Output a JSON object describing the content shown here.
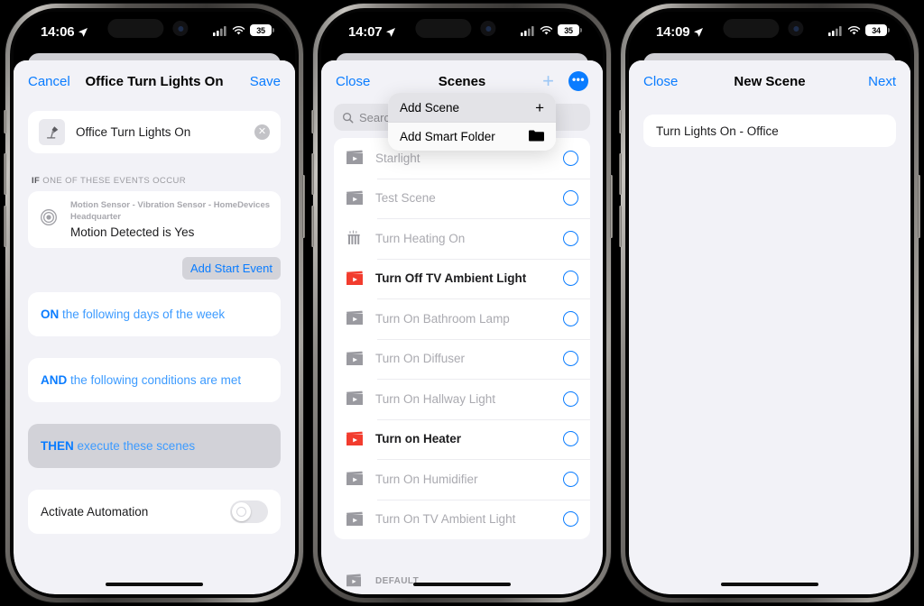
{
  "phones": [
    {
      "status": {
        "time": "14:06",
        "battery": "35",
        "location_icon": "location-arrow-icon",
        "signal_icon": "cellular-signal-icon",
        "wifi_icon": "wifi-icon"
      },
      "nav": {
        "left": "Cancel",
        "title": "Office Turn Lights On",
        "right": "Save"
      },
      "name_field": {
        "icon": "desk-lamp-icon",
        "value": "Office Turn Lights On",
        "clear": "✕"
      },
      "if_section": {
        "prefix": "IF",
        "label": "ONE OF THESE EVENTS OCCUR"
      },
      "event": {
        "icon": "motion-sensor-icon",
        "subtitle": "Motion Sensor - Vibration Sensor - HomeDevices Headquarter",
        "title": "Motion Detected is Yes"
      },
      "add_start_event": "Add Start Event",
      "rules": [
        {
          "keyword": "ON",
          "text": " the following days of the week",
          "pressed": false
        },
        {
          "keyword": "AND",
          "text": " the following conditions are met",
          "pressed": false
        },
        {
          "keyword": "THEN",
          "text": " execute these scenes",
          "pressed": true
        }
      ],
      "toggle": {
        "label": "Activate Automation",
        "state": "off"
      }
    },
    {
      "status": {
        "time": "14:07",
        "battery": "35"
      },
      "nav": {
        "left": "Close",
        "title": "Scenes",
        "add_icon": "plus-icon",
        "more_icon": "ellipsis-circle-icon"
      },
      "search": {
        "placeholder": "Search",
        "icon": "search-icon"
      },
      "context_menu": [
        {
          "label": "Add Scene",
          "icon": "plus-icon"
        },
        {
          "label": "Add Smart Folder",
          "icon": "folder-icon"
        }
      ],
      "scenes": [
        {
          "label": "Starlight",
          "icon": "scene-clapper-icon",
          "accent": "#9a9aa0",
          "active": false
        },
        {
          "label": "Test Scene",
          "icon": "scene-clapper-icon",
          "accent": "#9a9aa0",
          "active": false
        },
        {
          "label": "Turn Heating On",
          "icon": "radiator-icon",
          "accent": "#9a9aa0",
          "active": false
        },
        {
          "label": "Turn Off TV Ambient Light",
          "icon": "scene-clapper-icon",
          "accent": "#f23c2e",
          "active": true
        },
        {
          "label": "Turn On Bathroom Lamp",
          "icon": "scene-clapper-icon",
          "accent": "#9a9aa0",
          "active": false
        },
        {
          "label": "Turn On Diffuser",
          "icon": "scene-clapper-icon",
          "accent": "#9a9aa0",
          "active": false
        },
        {
          "label": "Turn On Hallway Light",
          "icon": "scene-clapper-icon",
          "accent": "#9a9aa0",
          "active": false
        },
        {
          "label": "Turn on Heater",
          "icon": "scene-clapper-icon",
          "accent": "#f23c2e",
          "active": true
        },
        {
          "label": "Turn On Humidifier",
          "icon": "scene-clapper-icon",
          "accent": "#9a9aa0",
          "active": false
        },
        {
          "label": "Turn On TV Ambient Light",
          "icon": "scene-clapper-icon",
          "accent": "#9a9aa0",
          "active": false
        }
      ],
      "partial_row": {
        "label": "DEFAULT",
        "icon": "scene-clapper-icon"
      }
    },
    {
      "status": {
        "time": "14:09",
        "battery": "34"
      },
      "nav": {
        "left": "Close",
        "title": "New Scene",
        "right": "Next"
      },
      "name_field": {
        "value": "Turn Lights On - Office"
      }
    }
  ],
  "colors": {
    "accent_blue": "#0a7cff",
    "background": "#f2f2f7",
    "red": "#f23c2e"
  }
}
